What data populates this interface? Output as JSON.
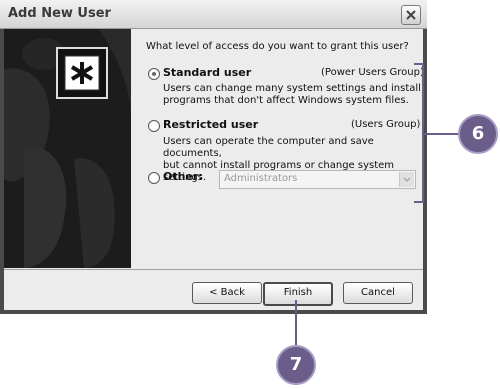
{
  "window": {
    "title": "Add New User"
  },
  "question": "What level of access do you want to grant this user?",
  "options": [
    {
      "label": "Standard user",
      "group": "(Power Users Group)",
      "desc_lines": [
        "Users can change many system settings and install",
        "programs that don't affect Windows system files."
      ],
      "selected": true
    },
    {
      "label": "Restricted user",
      "group": "(Users Group)",
      "desc_lines": [
        "Users can operate the computer and save documents,",
        "but cannot install programs or change system settings."
      ],
      "selected": false
    },
    {
      "label": "Other:",
      "combo_value": "Administrators",
      "selected": false
    }
  ],
  "buttons": {
    "back": "< Back",
    "finish": "Finish",
    "cancel": "Cancel"
  },
  "callouts": {
    "options": "6",
    "finish": "7"
  },
  "colors": {
    "callout": "#6a5d8a",
    "side_panel": "#1c1c1c"
  }
}
